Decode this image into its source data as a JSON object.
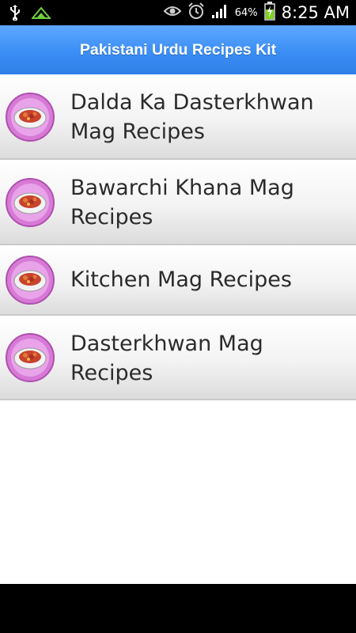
{
  "status_bar": {
    "battery_percent": "64%",
    "time": "8:25 AM",
    "icons": [
      "usb-icon",
      "notification-icon",
      "eye-icon",
      "alarm-icon",
      "signal-icon",
      "battery-charging-icon"
    ]
  },
  "header": {
    "title": "Pakistani Urdu Recipes Kit"
  },
  "recipes": [
    {
      "label": "Dalda Ka Dasterkhwan Mag Recipes",
      "icon": "recipe-dish-icon"
    },
    {
      "label": "Bawarchi Khana Mag Recipes",
      "icon": "recipe-dish-icon"
    },
    {
      "label": "Kitchen Mag Recipes",
      "icon": "recipe-dish-icon"
    },
    {
      "label": "Dasterkhwan Mag Recipes",
      "icon": "recipe-dish-icon"
    }
  ],
  "colors": {
    "title_bar": "#3b8ef5",
    "icon_badge": "#d67ad6",
    "list_text": "#2b2b2b"
  }
}
